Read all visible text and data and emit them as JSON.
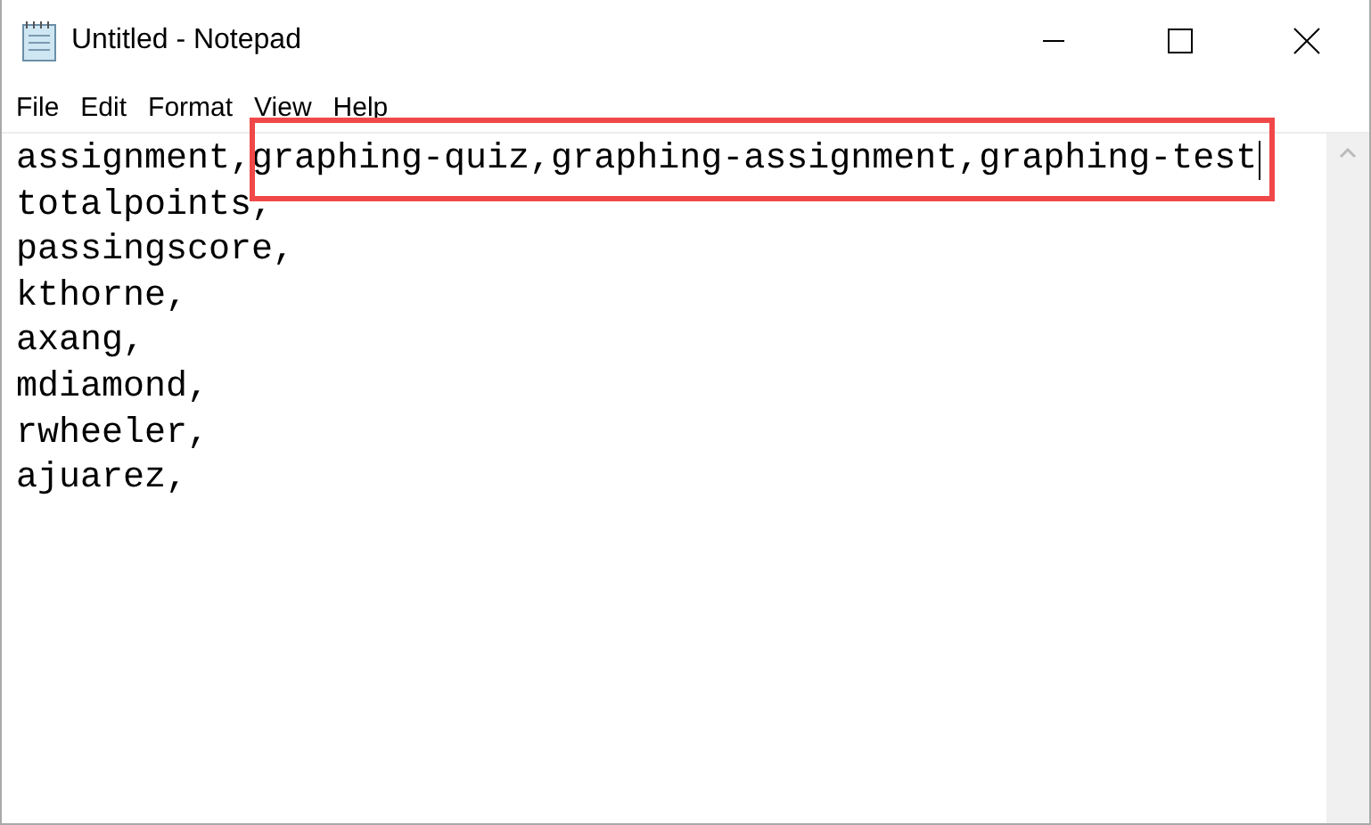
{
  "window": {
    "title": "Untitled - Notepad"
  },
  "menu": [
    "File",
    "Edit",
    "Format",
    "View",
    "Help"
  ],
  "lines": [
    {
      "parts": [
        {
          "text": "assignment,",
          "highlighted": false
        },
        {
          "text": "graphing-quiz,graphing-assignment,graphing-test",
          "highlighted": true
        }
      ]
    },
    {
      "parts": [
        {
          "text": "totalpoints,",
          "highlighted": false
        }
      ]
    },
    {
      "parts": [
        {
          "text": "passingscore,",
          "highlighted": false
        }
      ]
    },
    {
      "parts": [
        {
          "text": "kthorne,",
          "highlighted": false
        }
      ]
    },
    {
      "parts": [
        {
          "text": "axang,",
          "highlighted": false
        }
      ]
    },
    {
      "parts": [
        {
          "text": "mdiamond,",
          "highlighted": false
        }
      ]
    },
    {
      "parts": [
        {
          "text": "rwheeler,",
          "highlighted": false
        }
      ]
    },
    {
      "parts": [
        {
          "text": "ajuarez,",
          "highlighted": false
        }
      ]
    }
  ]
}
